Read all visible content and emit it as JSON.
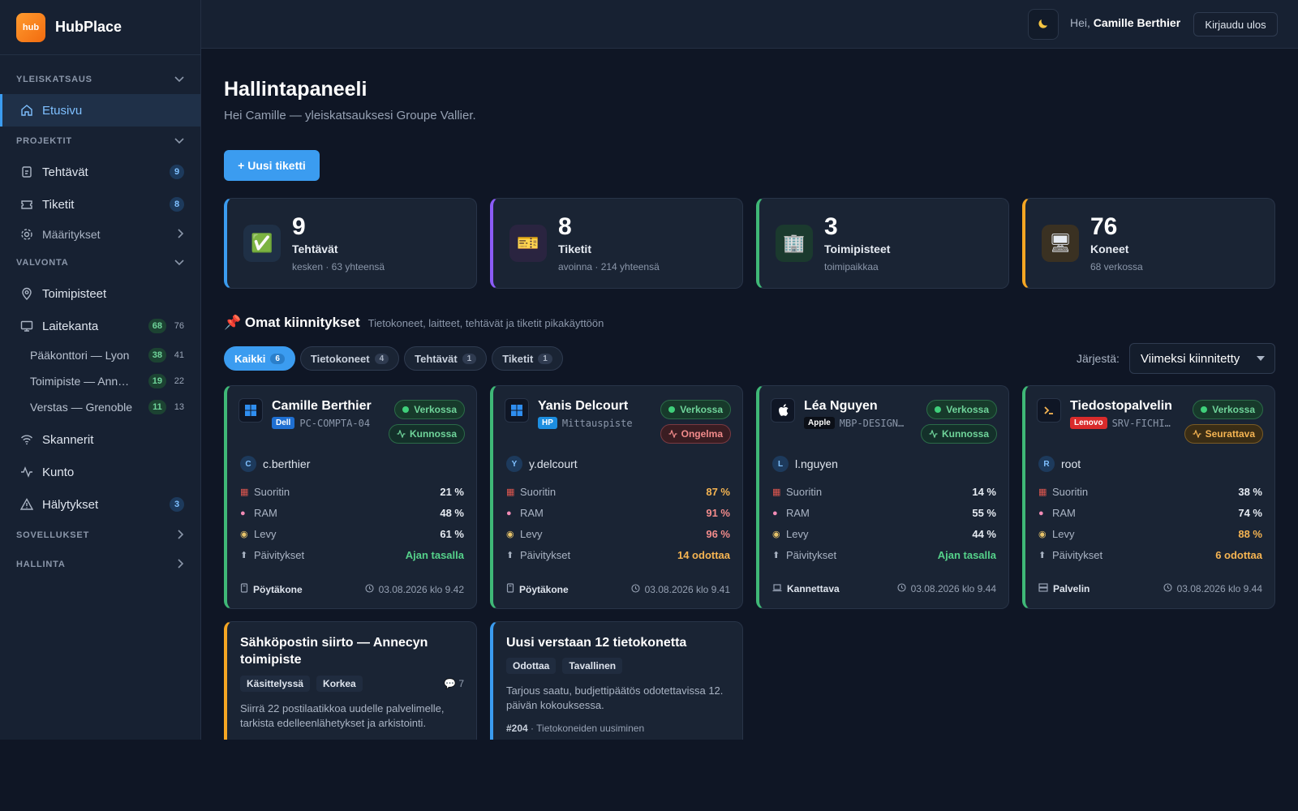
{
  "app": {
    "logo_text": "hub",
    "name": "HubPlace"
  },
  "topbar": {
    "theme_icon": "moon-icon",
    "greeting_prefix": "Hei, ",
    "user_name": "Camille Berthier",
    "logout_label": "Kirjaudu ulos"
  },
  "sidebar": {
    "sections": {
      "overview": "YLEISKATSAUS",
      "projects": "PROJEKTIT",
      "monitoring": "VALVONTA",
      "apps": "SOVELLUKSET",
      "admin": "HALLINTA"
    },
    "home": "Etusivu",
    "tasks": {
      "label": "Tehtävät",
      "badge": "9"
    },
    "tickets": {
      "label": "Tiketit",
      "badge": "8"
    },
    "settings": "Määritykset",
    "sites": "Toimipisteet",
    "inventory": {
      "label": "Laitekanta",
      "online": "68",
      "total": "76"
    },
    "inventory_sites": [
      {
        "label": "Pääkonttori — Lyon",
        "online": "38",
        "total": "41"
      },
      {
        "label": "Toimipiste — Ann…",
        "online": "19",
        "total": "22"
      },
      {
        "label": "Verstas — Grenoble",
        "online": "11",
        "total": "13"
      }
    ],
    "scanners": "Skannerit",
    "health": "Kunto",
    "alerts": {
      "label": "Hälytykset",
      "badge": "3"
    }
  },
  "main": {
    "title": "Hallintapaneeli",
    "subtitle": "Hei Camille — yleiskatsauksesi Groupe Vallier.",
    "new_ticket": "+ Uusi tiketti"
  },
  "stats": [
    {
      "value": "9",
      "label": "Tehtävät",
      "sub": "kesken · 63 yhteensä",
      "icon": "✅",
      "accent": "#3b9cf0"
    },
    {
      "value": "8",
      "label": "Tiketit",
      "sub": "avoinna · 214 yhteensä",
      "icon": "🎫",
      "accent": "#8b5cf6"
    },
    {
      "value": "3",
      "label": "Toimipisteet",
      "sub": "toimipaikkaa",
      "icon": "🏢",
      "accent": "#3fb877"
    },
    {
      "value": "76",
      "label": "Koneet",
      "sub": "68 verkossa",
      "icon": "🖥",
      "accent": "#f5a623"
    }
  ],
  "pins": {
    "icon": "📌",
    "title": "Omat kiinnitykset",
    "desc": "Tietokoneet, laitteet, tehtävät ja tiketit pikakäyttöön",
    "filters": [
      {
        "label": "Kaikki",
        "count": "6"
      },
      {
        "label": "Tietokoneet",
        "count": "4"
      },
      {
        "label": "Tehtävät",
        "count": "1"
      },
      {
        "label": "Tiketit",
        "count": "1"
      }
    ],
    "sort_label": "Järjestä:",
    "sort_value": "Viimeksi kiinnitetty"
  },
  "metric_labels": {
    "cpu": "Suoritin",
    "ram": "RAM",
    "disk": "Levy",
    "updates": "Päivitykset"
  },
  "machines": [
    {
      "name": "Camille Berthier",
      "brand": "Dell",
      "brand_color": "#1f6fd1",
      "host": "PC-COMPTA-04",
      "os_icon": "windows-icon",
      "status": "Verkossa",
      "health": "Kunnossa",
      "health_level": "good",
      "user_initial": "C",
      "user": "c.berthier",
      "cpu": "21 %",
      "ram": "48 %",
      "disk": "61 %",
      "updates": "Ajan tasalla",
      "type": "Pöytäkone",
      "date": "03.08.2026 klo 9.42"
    },
    {
      "name": "Yanis Delcourt",
      "brand": "HP",
      "brand_color": "#1d8ee0",
      "host": "Mittauspiste",
      "os_icon": "windows-icon",
      "status": "Verkossa",
      "health": "Ongelma",
      "health_level": "bad",
      "user_initial": "Y",
      "user": "y.delcourt",
      "cpu": "87 %",
      "ram": "91 %",
      "disk": "96 %",
      "updates": "14 odottaa",
      "type": "Pöytäkone",
      "date": "03.08.2026 klo 9.41"
    },
    {
      "name": "Léa Nguyen",
      "brand": "Apple",
      "brand_color": "#0b0f17",
      "host": "MBP-DESIGN…",
      "os_icon": "apple-icon",
      "status": "Verkossa",
      "health": "Kunnossa",
      "health_level": "good",
      "user_initial": "L",
      "user": "l.nguyen",
      "cpu": "14 %",
      "ram": "55 %",
      "disk": "44 %",
      "updates": "Ajan tasalla",
      "type": "Kannettava",
      "date": "03.08.2026 klo 9.44"
    },
    {
      "name": "Tiedostopalvelin",
      "brand": "Lenovo",
      "brand_color": "#d92b2b",
      "host": "SRV-FICHI…",
      "os_icon": "terminal-icon",
      "status": "Verkossa",
      "health": "Seurattava",
      "health_level": "watch",
      "user_initial": "R",
      "user": "root",
      "cpu": "38 %",
      "ram": "74 %",
      "disk": "88 %",
      "updates": "6 odottaa",
      "type": "Palvelin",
      "date": "03.08.2026 klo 9.44"
    }
  ],
  "tasks": [
    {
      "title": "Sähköpostin siirto — Annecyn toimipiste",
      "status": "Käsittelyssä",
      "priority": "Korkea",
      "comments": "7",
      "desc": "Siirrä 22 postilaatikkoa uudelle palvelimelle, tarkista edelleenlähetykset ja arkistointi.",
      "accent": "#f5a623"
    },
    {
      "title": "Uusi verstaan 12 tietokonetta",
      "status": "Odottaa",
      "priority": "Tavallinen",
      "desc": "Tarjous saatu, budjettipäätös odotettavissa 12. päivän kokouksessa.",
      "ref_id": "#204",
      "ref_text": " · Tietokoneiden uusiminen",
      "accent": "#3b9cf0"
    }
  ]
}
